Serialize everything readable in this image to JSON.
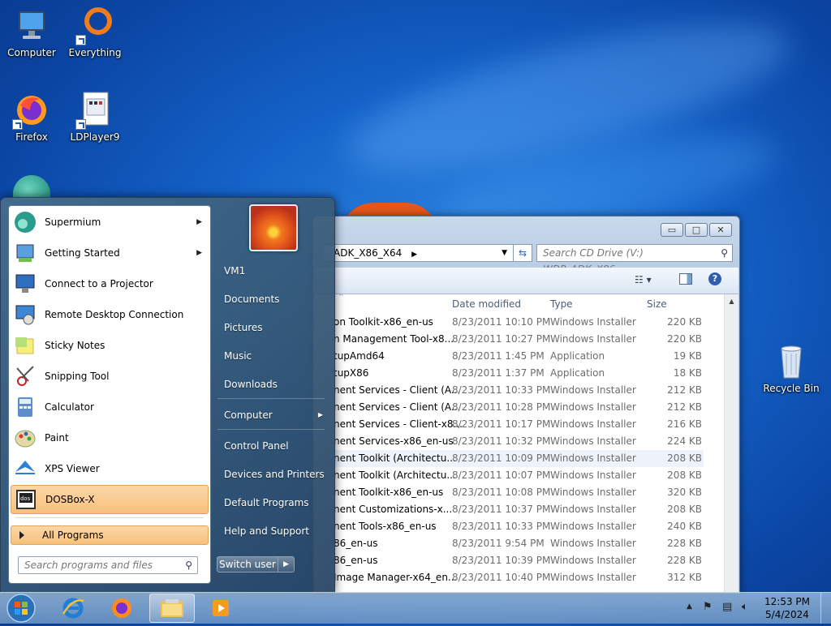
{
  "desktop": {
    "icons": [
      {
        "label": "Computer"
      },
      {
        "label": "Everything"
      },
      {
        "label": "Firefox"
      },
      {
        "label": "LDPlayer9"
      },
      {
        "label": "Recycle Bin"
      }
    ]
  },
  "explorer": {
    "address_crumb": "ADK_X86_X64",
    "search_placeholder": "Search CD Drive (V:) WDP_ADK_X86_...",
    "columns": {
      "date": "Date modified",
      "type": "Type",
      "size": "Size"
    },
    "rows": [
      {
        "name": "on Toolkit-x86_en-us",
        "date": "8/23/2011 10:10 PM",
        "type": "Windows Installer ...",
        "size": "220 KB"
      },
      {
        "name": "n Management Tool-x8...",
        "date": "8/23/2011 10:27 PM",
        "type": "Windows Installer ...",
        "size": "220 KB"
      },
      {
        "name": "tupAmd64",
        "date": "8/23/2011 1:45 PM",
        "type": "Application",
        "size": "19 KB"
      },
      {
        "name": "tupX86",
        "date": "8/23/2011 1:37 PM",
        "type": "Application",
        "size": "18 KB"
      },
      {
        "name": "nent Services - Client (A...",
        "date": "8/23/2011 10:33 PM",
        "type": "Windows Installer ...",
        "size": "212 KB"
      },
      {
        "name": "nent Services - Client (A...",
        "date": "8/23/2011 10:28 PM",
        "type": "Windows Installer ...",
        "size": "212 KB"
      },
      {
        "name": "nent Services - Client-x8...",
        "date": "8/23/2011 10:17 PM",
        "type": "Windows Installer ...",
        "size": "216 KB"
      },
      {
        "name": "nent Services-x86_en-us",
        "date": "8/23/2011 10:32 PM",
        "type": "Windows Installer ...",
        "size": "224 KB"
      },
      {
        "name": "nent Toolkit (Architectu...",
        "date": "8/23/2011 10:09 PM",
        "type": "Windows Installer ...",
        "size": "208 KB"
      },
      {
        "name": "nent Toolkit (Architectu...",
        "date": "8/23/2011 10:07 PM",
        "type": "Windows Installer ...",
        "size": "208 KB"
      },
      {
        "name": "nent Toolkit-x86_en-us",
        "date": "8/23/2011 10:08 PM",
        "type": "Windows Installer ...",
        "size": "320 KB"
      },
      {
        "name": "nent Customizations-x...",
        "date": "8/23/2011 10:37 PM",
        "type": "Windows Installer ...",
        "size": "208 KB"
      },
      {
        "name": "nent Tools-x86_en-us",
        "date": "8/23/2011 10:33 PM",
        "type": "Windows Installer ...",
        "size": "240 KB"
      },
      {
        "name": "86_en-us",
        "date": "8/23/2011 9:54 PM",
        "type": "Windows Installer ...",
        "size": "228 KB"
      },
      {
        "name": "86_en-us",
        "date": "8/23/2011 10:39 PM",
        "type": "Windows Installer ...",
        "size": "228 KB"
      },
      {
        "name": "Image Manager-x64_en...",
        "date": "8/23/2011 10:40 PM",
        "type": "Windows Installer ...",
        "size": "312 KB"
      }
    ]
  },
  "startmenu": {
    "programs": [
      {
        "label": "Supermium",
        "submenu": true
      },
      {
        "label": "Getting Started",
        "submenu": true
      },
      {
        "label": "Connect to a Projector"
      },
      {
        "label": "Remote Desktop Connection"
      },
      {
        "label": "Sticky Notes"
      },
      {
        "label": "Snipping Tool"
      },
      {
        "label": "Calculator"
      },
      {
        "label": "Paint"
      },
      {
        "label": "XPS Viewer"
      },
      {
        "label": "DOSBox-X"
      }
    ],
    "all_programs": "All Programs",
    "search_placeholder": "Search programs and files",
    "right_links": [
      "VM1",
      "Documents",
      "Pictures",
      "Music",
      "Downloads",
      "Computer",
      "Control Panel",
      "Devices and Printers",
      "Default Programs",
      "Help and Support"
    ],
    "switch_user": "Switch user"
  },
  "taskbar": {
    "time": "12:53 PM",
    "date": "5/4/2024"
  }
}
